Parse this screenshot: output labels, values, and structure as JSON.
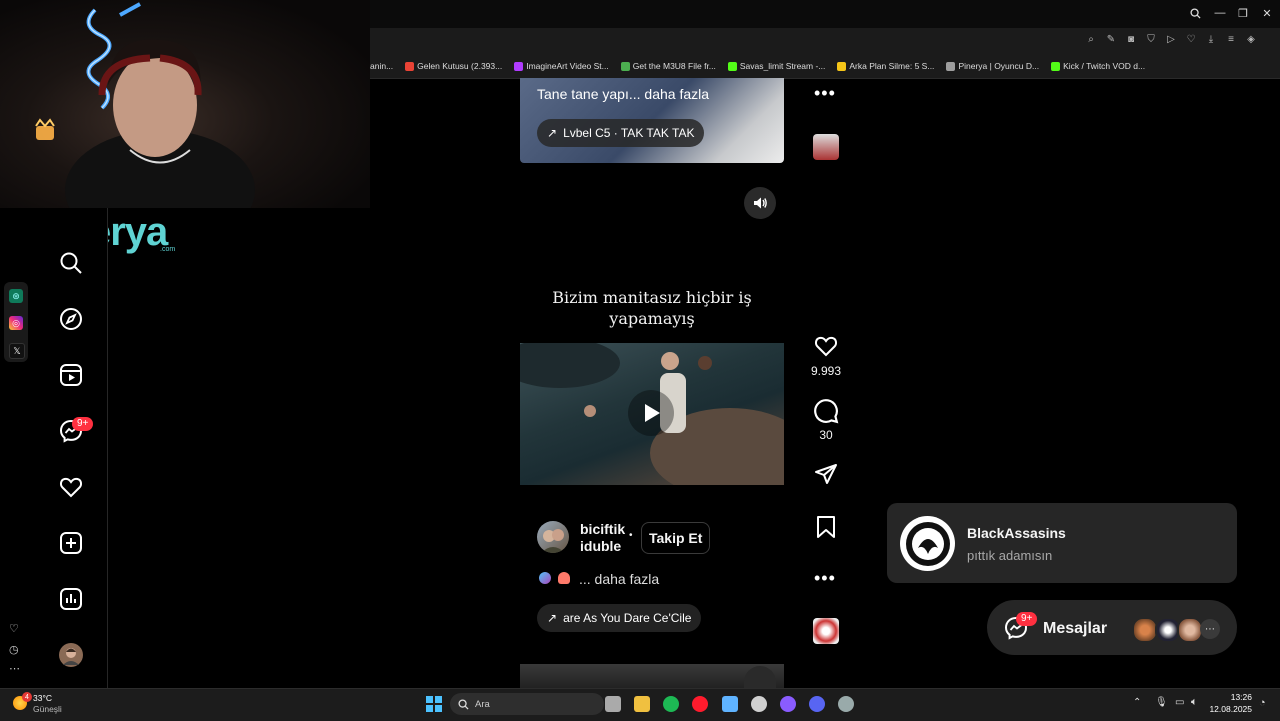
{
  "bookmarks": [
    {
      "label": "anin...",
      "color": "#888888"
    },
    {
      "label": "Gelen Kutusu (2.393...",
      "color": "#ea4335"
    },
    {
      "label": "ImagineArt Video St...",
      "color": "#b03cff"
    },
    {
      "label": "Get the M3U8 File fr...",
      "color": "#4caf50"
    },
    {
      "label": "Savas_limit Stream -...",
      "color": "#53fc18"
    },
    {
      "label": "Arka Plan Silme: 5 S...",
      "color": "#f5c518"
    },
    {
      "label": "Pinerya | Oyuncu D...",
      "color": "#9e9e9e"
    },
    {
      "label": "Kick / Twitch VOD d...",
      "color": "#53fc18"
    }
  ],
  "logo": {
    "text": "pinerya",
    "sub": ".com"
  },
  "nav": {
    "messages_badge": "9+"
  },
  "post1": {
    "caption": "Tane tane yapı... daha fazla",
    "music": "Lvbel C5 · TAK TAK TAK"
  },
  "post2": {
    "overlay_text": "Bizim manitasız hiçbir iş yapamayış",
    "likes": "9.993",
    "comments": "30",
    "username_line1": "biciftik",
    "username_line2": "iduble",
    "separator": "•",
    "follow": "Takip Et",
    "caption": "... daha fazla",
    "music": "are As You Dare  Ce'Cile"
  },
  "toast": {
    "name": "BlackAssasins",
    "message": "pıttık adamısın"
  },
  "messages": {
    "label": "Mesajlar",
    "badge": "9+"
  },
  "taskbar": {
    "weather_badge": "4",
    "temp": "33°C",
    "weather": "Güneşli",
    "search": "Ara",
    "time": "13:26",
    "date": "12.08.2025"
  },
  "colors": {
    "accent": "#ff3040",
    "bg": "#000000",
    "card": "#262626"
  }
}
